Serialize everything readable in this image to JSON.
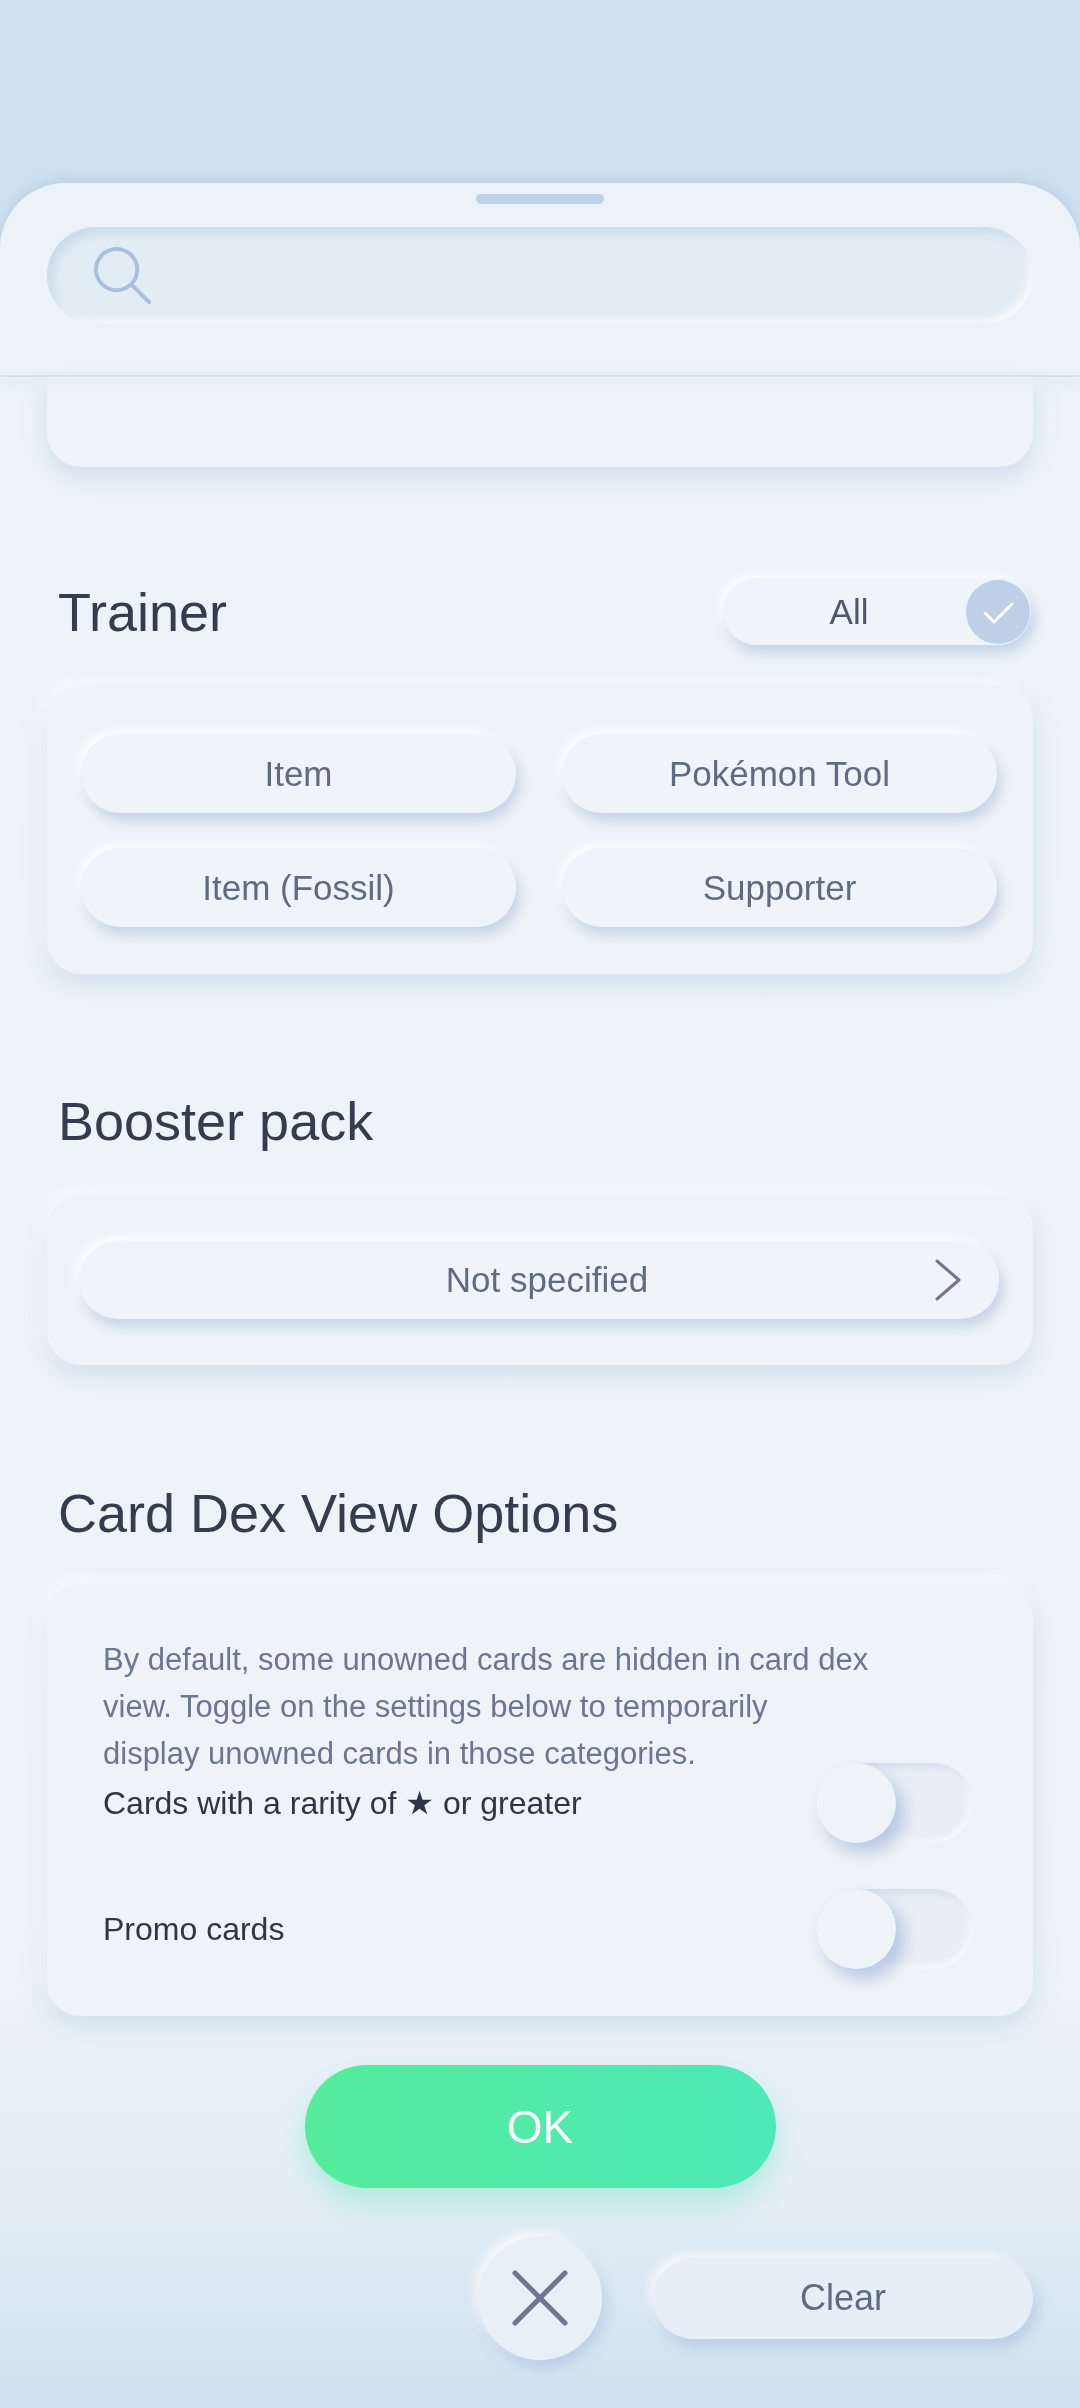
{
  "trainer": {
    "title": "Trainer",
    "all_filter": {
      "label": "All",
      "checked": true
    },
    "options": [
      {
        "label": "Item",
        "selected": false
      },
      {
        "label": "Pokémon Tool",
        "selected": false
      },
      {
        "label": "Item (Fossil)",
        "selected": false
      },
      {
        "label": "Supporter",
        "selected": false
      }
    ]
  },
  "booster_pack": {
    "title": "Booster pack",
    "value": "Not specified"
  },
  "card_dex_view_options": {
    "title": "Card Dex View Options",
    "description": "By default, some unowned cards are hidden in card dex view. Toggle on the settings below to temporarily display unowned cards in those categories.",
    "settings": [
      {
        "label": "Cards with a rarity of ★ or greater",
        "on": false
      },
      {
        "label": "Promo cards",
        "on": false
      }
    ]
  },
  "footer": {
    "ok_label": "OK",
    "clear_label": "Clear"
  }
}
